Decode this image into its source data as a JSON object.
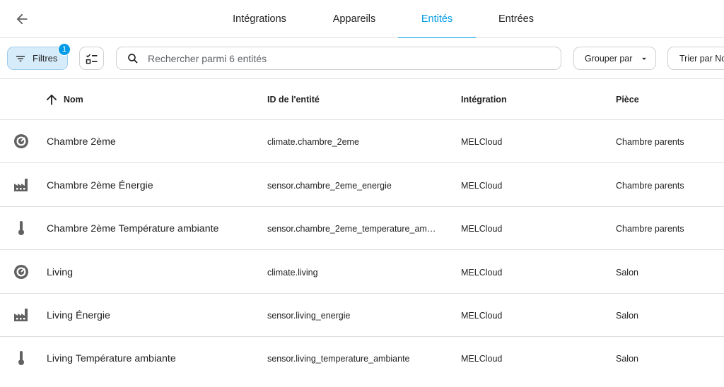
{
  "tabs": [
    {
      "label": "Intégrations",
      "active": false
    },
    {
      "label": "Appareils",
      "active": false
    },
    {
      "label": "Entités",
      "active": true
    },
    {
      "label": "Entrées",
      "active": false
    }
  ],
  "toolbar": {
    "filters_label": "Filtres",
    "filters_count": "1",
    "search_placeholder": "Rechercher parmi 6 entités",
    "group_label": "Grouper par",
    "sort_label": "Trier par Nom"
  },
  "table": {
    "headers": {
      "name": "Nom",
      "entity_id": "ID de l'entité",
      "integration": "Intégration",
      "area": "Pièce"
    },
    "rows": [
      {
        "icon": "thermostat-icon",
        "name": "Chambre 2ème",
        "entity_id": "climate.chambre_2eme",
        "integration": "MELCloud",
        "area": "Chambre parents"
      },
      {
        "icon": "factory-icon",
        "name": "Chambre 2ème Énergie",
        "entity_id": "sensor.chambre_2eme_energie",
        "integration": "MELCloud",
        "area": "Chambre parents"
      },
      {
        "icon": "thermometer-icon",
        "name": "Chambre 2ème Température ambiante",
        "entity_id": "sensor.chambre_2eme_temperature_am…",
        "integration": "MELCloud",
        "area": "Chambre parents"
      },
      {
        "icon": "thermostat-icon",
        "name": "Living",
        "entity_id": "climate.living",
        "integration": "MELCloud",
        "area": "Salon"
      },
      {
        "icon": "factory-icon",
        "name": "Living Énergie",
        "entity_id": "sensor.living_energie",
        "integration": "MELCloud",
        "area": "Salon"
      },
      {
        "icon": "thermometer-icon",
        "name": "Living Température ambiante",
        "entity_id": "sensor.living_temperature_ambiante",
        "integration": "MELCloud",
        "area": "Salon"
      }
    ]
  },
  "colors": {
    "accent": "#039be5",
    "icon": "#616161",
    "filter_bg": "#d7ecfa"
  }
}
